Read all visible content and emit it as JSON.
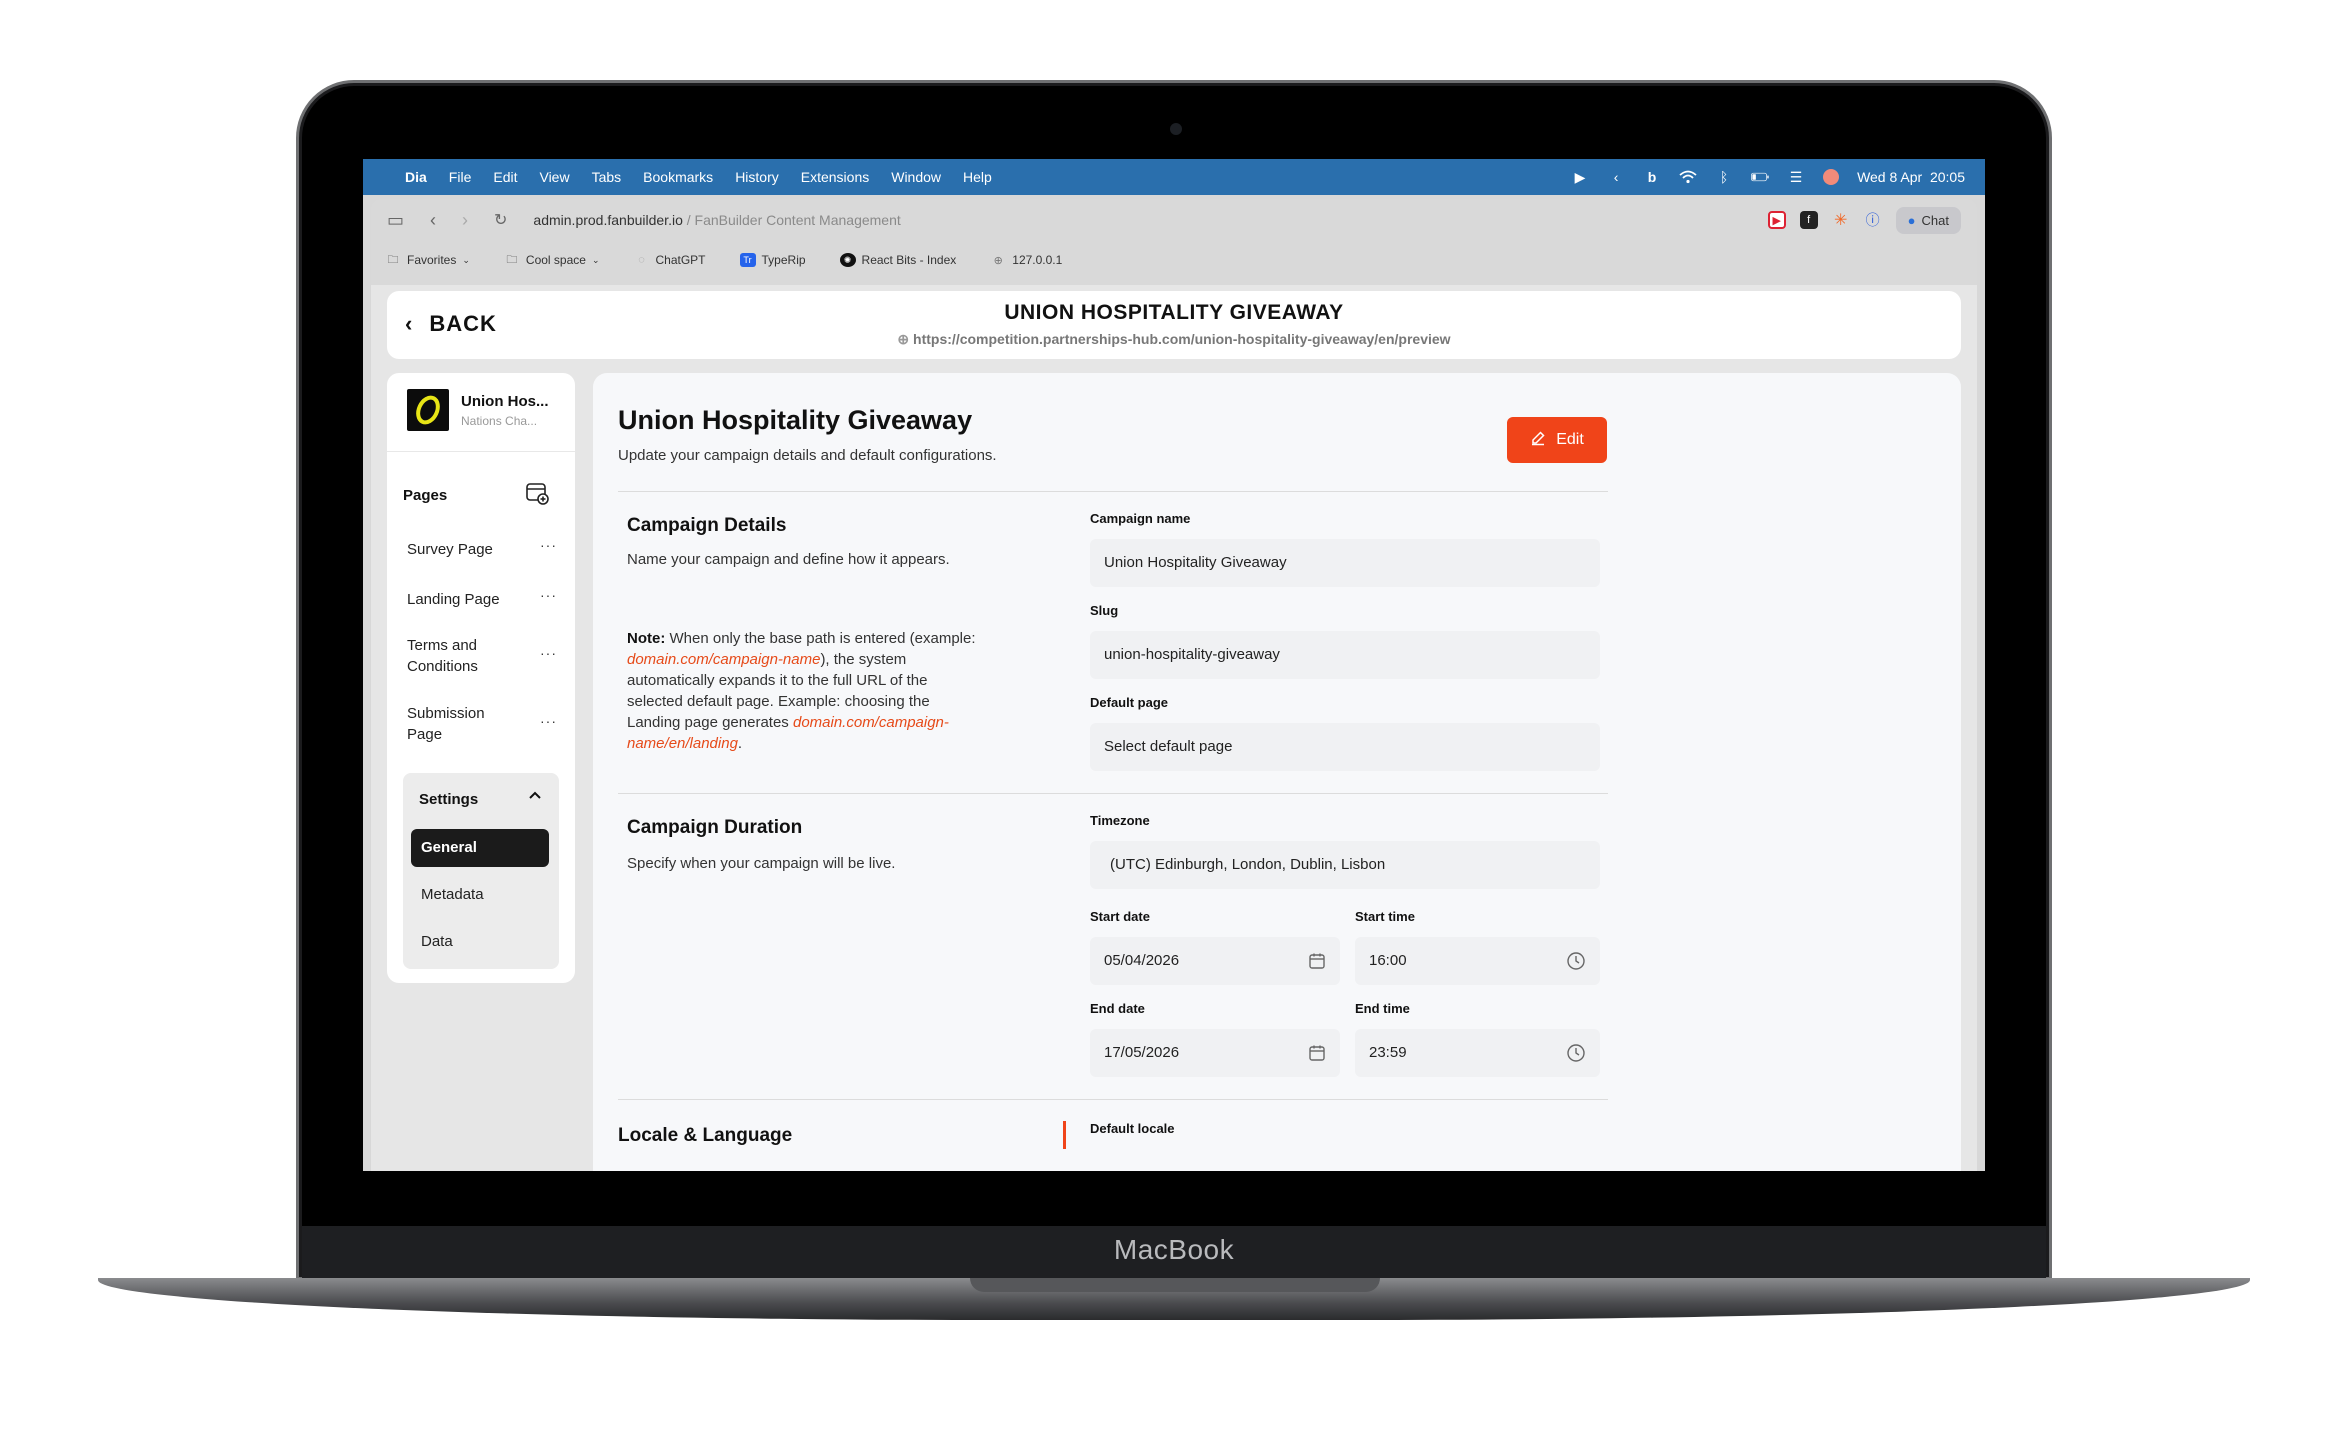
{
  "laptop": {
    "brand": "MacBook"
  },
  "menubar": {
    "app": "Dia",
    "items": [
      "File",
      "Edit",
      "View",
      "Tabs",
      "Bookmarks",
      "History",
      "Extensions",
      "Window",
      "Help"
    ],
    "datetime": "Wed 8 Apr  20:05"
  },
  "browser": {
    "url_host": "admin.prod.fanbuilder.io",
    "url_path": " / FanBuilder Content Management",
    "chat_label": "Chat",
    "bookmarks": [
      {
        "label": "Favorites",
        "icon": "folder-icon"
      },
      {
        "label": "Cool space",
        "icon": "folder-icon"
      },
      {
        "label": "ChatGPT",
        "icon": "chatgpt-icon"
      },
      {
        "label": "TypeRip",
        "icon": "typerip-icon"
      },
      {
        "label": "React Bits - Index",
        "icon": "react-bits-icon"
      },
      {
        "label": "127.0.0.1",
        "icon": "globe-icon"
      }
    ]
  },
  "header": {
    "back_label": "BACK",
    "title": "UNION HOSPITALITY GIVEAWAY",
    "preview_url": "https://competition.partnerships-hub.com/union-hospitality-giveaway/en/preview"
  },
  "sidebar": {
    "org_name": "Union Hos...",
    "org_sub": "Nations Cha...",
    "pages_heading": "Pages",
    "pages": [
      "Survey Page",
      "Landing Page",
      "Terms and Conditions",
      "Submission Page"
    ],
    "settings_heading": "Settings",
    "settings_items": [
      "General",
      "Metadata",
      "Data"
    ],
    "active_setting": "General"
  },
  "main": {
    "title": "Union Hospitality Giveaway",
    "subtitle": "Update your campaign details and default configurations.",
    "edit_label": "Edit",
    "details": {
      "title": "Campaign Details",
      "desc": "Name your campaign and define how it appears.",
      "note_label": "Note:",
      "note_1": " When only the base path is entered (example: ",
      "note_link_1": "domain.com/campaign-name",
      "note_2": "), the system automatically expands it to the full URL of the selected default page. Example: choosing the Landing page generates ",
      "note_link_2": "domain.com/campaign-name/en/landing",
      "note_3": ".",
      "name_label": "Campaign name",
      "name_value": "Union Hospitality Giveaway",
      "slug_label": "Slug",
      "slug_value": "union-hospitality-giveaway",
      "default_page_label": "Default page",
      "default_page_value": "Select default page"
    },
    "duration": {
      "title": "Campaign Duration",
      "desc": "Specify when your campaign will be live.",
      "timezone_label": "Timezone",
      "timezone_value": "(UTC) Edinburgh, London, Dublin, Lisbon",
      "start_date_label": "Start date",
      "start_date_value": "05/04/2026",
      "start_time_label": "Start time",
      "start_time_value": "16:00",
      "end_date_label": "End date",
      "end_date_value": "17/05/2026",
      "end_time_label": "End time",
      "end_time_value": "23:59"
    },
    "locale": {
      "title": "Locale & Language",
      "default_locale_label": "Default locale"
    }
  }
}
